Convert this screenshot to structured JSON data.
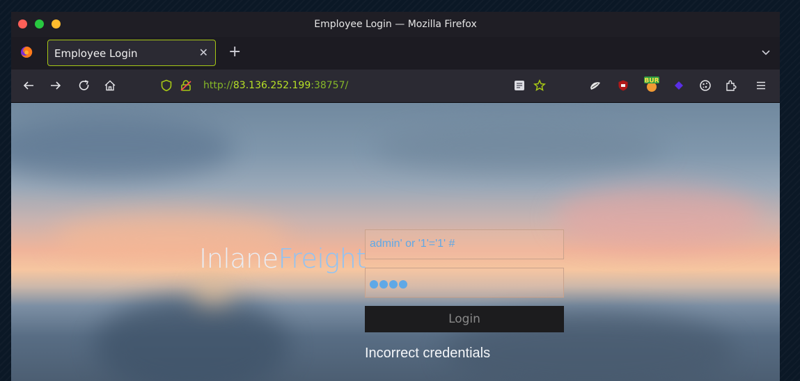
{
  "window": {
    "title": "Employee Login — Mozilla Firefox"
  },
  "tabs": [
    {
      "label": "Employee Login",
      "active": true
    }
  ],
  "navbar": {
    "url_scheme": "http://",
    "url_host": "83.136.252.199",
    "url_port_path": ":38757/",
    "icons": [
      "back-icon",
      "forward-icon",
      "reload-icon",
      "home-icon",
      "shield-icon",
      "insecure-lock-icon",
      "reader-view-icon",
      "bookmark-star-icon",
      "extension-icon",
      "ublock-icon",
      "burp-icon",
      "extension-diamond-icon",
      "cookie-icon",
      "extensions-puzzle-icon",
      "menu-icon"
    ]
  },
  "page": {
    "brand_primary": "Inlane",
    "brand_accent": "Freight",
    "username_value": "admin' or '1'='1' #",
    "password_mask_count": 4,
    "login_label": "Login",
    "error_message": "Incorrect credentials",
    "burp_badge": "BUR"
  },
  "colors": {
    "tab_border": "#a7c815",
    "url_host": "#b8e226",
    "brand_accent": "#8ec3f5",
    "input_text": "#5fa8e6"
  }
}
